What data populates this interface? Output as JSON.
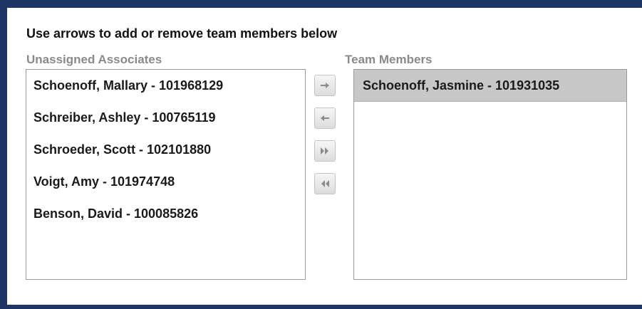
{
  "instructions": "Use arrows to add or remove team members below",
  "unassigned": {
    "label": "Unassigned Associates",
    "items": [
      "Schoenoff, Mallary - 101968129",
      "Schreiber, Ashley - 100765119",
      "Schroeder, Scott - 102101880",
      "Voigt, Amy - 101974748",
      "Benson, David - 100085826"
    ]
  },
  "team": {
    "label": "Team Members",
    "items": [
      "Schoenoff, Jasmine - 101931035"
    ],
    "selected_index": 0
  },
  "buttons": {
    "move_right_icon": "arrow-right-icon",
    "move_left_icon": "arrow-left-icon",
    "move_all_right_icon": "double-chevron-right-icon",
    "move_all_left_icon": "double-chevron-left-icon"
  },
  "colors": {
    "frame": "#1f3566",
    "selected_row": "#c8c8c8",
    "label_gray": "#8a8a8a"
  }
}
